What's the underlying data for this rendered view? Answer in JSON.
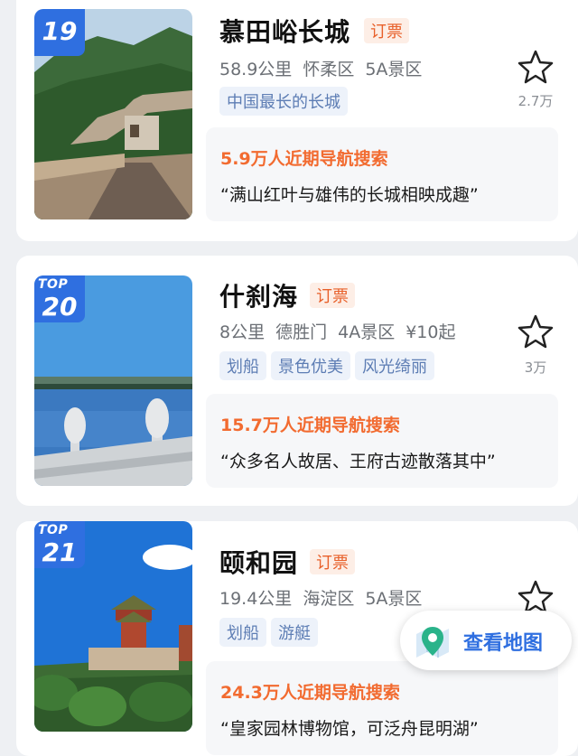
{
  "colors": {
    "accent": "#2f6fe0",
    "ticket": "#e8602a",
    "hot": "#f26b30",
    "tag": "#5d7db4"
  },
  "items": [
    {
      "rank_prefix": "",
      "rank": "19",
      "name": "慕田峪长城",
      "ticket": "订票",
      "distance": "58.9公里",
      "district": "怀柔区",
      "level": "5A景区",
      "price": "",
      "tags": [
        "中国最长的长城"
      ],
      "fav_count": "2.7万",
      "hot_text": "5.9万人近期导航搜索",
      "quote": "“满山红叶与雄伟的长城相映成趣”",
      "image": "great-wall-photo"
    },
    {
      "rank_prefix": "TOP",
      "rank": "20",
      "name": "什刹海",
      "ticket": "订票",
      "distance": "8公里",
      "district": "德胜门",
      "level": "4A景区",
      "price": "¥10起",
      "tags": [
        "划船",
        "景色优美",
        "风光绮丽"
      ],
      "fav_count": "3万",
      "hot_text": "15.7万人近期导航搜索",
      "quote": "“众多名人故居、王府古迹散落其中”",
      "image": "lake-photo"
    },
    {
      "rank_prefix": "TOP",
      "rank": "21",
      "name": "颐和园",
      "ticket": "订票",
      "distance": "19.4公里",
      "district": "海淀区",
      "level": "5A景区",
      "price": "",
      "tags": [
        "划船",
        "游艇"
      ],
      "fav_count": "",
      "hot_text": "24.3万人近期导航搜索",
      "quote": "“皇家园林博物馆，可泛舟昆明湖”",
      "image": "summer-palace-photo"
    }
  ],
  "map_button": {
    "label": "查看地图",
    "icon": "map-pin-icon"
  }
}
